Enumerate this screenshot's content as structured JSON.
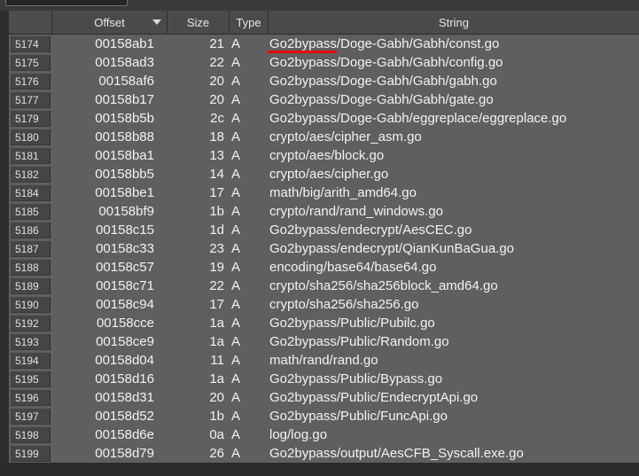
{
  "table": {
    "columns": {
      "offset": "Offset",
      "size": "Size",
      "type": "Type",
      "string": "String"
    },
    "sorted_column": "Offset",
    "rows": [
      {
        "num": "5174",
        "offset": "00158ab1",
        "size": "21",
        "type": "A",
        "string": "Go2bypass/Doge-Gabh/Gabh/const.go"
      },
      {
        "num": "5175",
        "offset": "00158ad3",
        "size": "22",
        "type": "A",
        "string": "Go2bypass/Doge-Gabh/Gabh/config.go"
      },
      {
        "num": "5176",
        "offset": "00158af6",
        "size": "20",
        "type": "A",
        "string": "Go2bypass/Doge-Gabh/Gabh/gabh.go"
      },
      {
        "num": "5177",
        "offset": "00158b17",
        "size": "20",
        "type": "A",
        "string": "Go2bypass/Doge-Gabh/Gabh/gate.go"
      },
      {
        "num": "5179",
        "offset": "00158b5b",
        "size": "2c",
        "type": "A",
        "string": "Go2bypass/Doge-Gabh/eggreplace/eggreplace.go"
      },
      {
        "num": "5180",
        "offset": "00158b88",
        "size": "18",
        "type": "A",
        "string": "crypto/aes/cipher_asm.go"
      },
      {
        "num": "5181",
        "offset": "00158ba1",
        "size": "13",
        "type": "A",
        "string": "crypto/aes/block.go"
      },
      {
        "num": "5182",
        "offset": "00158bb5",
        "size": "14",
        "type": "A",
        "string": "crypto/aes/cipher.go"
      },
      {
        "num": "5184",
        "offset": "00158be1",
        "size": "17",
        "type": "A",
        "string": "math/big/arith_amd64.go"
      },
      {
        "num": "5185",
        "offset": "00158bf9",
        "size": "1b",
        "type": "A",
        "string": "crypto/rand/rand_windows.go"
      },
      {
        "num": "5186",
        "offset": "00158c15",
        "size": "1d",
        "type": "A",
        "string": "Go2bypass/endecrypt/AesCEC.go"
      },
      {
        "num": "5187",
        "offset": "00158c33",
        "size": "23",
        "type": "A",
        "string": "Go2bypass/endecrypt/QianKunBaGua.go"
      },
      {
        "num": "5188",
        "offset": "00158c57",
        "size": "19",
        "type": "A",
        "string": "encoding/base64/base64.go"
      },
      {
        "num": "5189",
        "offset": "00158c71",
        "size": "22",
        "type": "A",
        "string": "crypto/sha256/sha256block_amd64.go"
      },
      {
        "num": "5190",
        "offset": "00158c94",
        "size": "17",
        "type": "A",
        "string": "crypto/sha256/sha256.go"
      },
      {
        "num": "5192",
        "offset": "00158cce",
        "size": "1a",
        "type": "A",
        "string": "Go2bypass/Public/Pubilc.go"
      },
      {
        "num": "5193",
        "offset": "00158ce9",
        "size": "1a",
        "type": "A",
        "string": "Go2bypass/Public/Random.go"
      },
      {
        "num": "5194",
        "offset": "00158d04",
        "size": "11",
        "type": "A",
        "string": "math/rand/rand.go"
      },
      {
        "num": "5195",
        "offset": "00158d16",
        "size": "1a",
        "type": "A",
        "string": "Go2bypass/Public/Bypass.go"
      },
      {
        "num": "5196",
        "offset": "00158d31",
        "size": "20",
        "type": "A",
        "string": "Go2bypass/Public/EndecryptApi.go"
      },
      {
        "num": "5197",
        "offset": "00158d52",
        "size": "1b",
        "type": "A",
        "string": "Go2bypass/Public/FuncApi.go"
      },
      {
        "num": "5198",
        "offset": "00158d6e",
        "size": "0a",
        "type": "A",
        "string": "log/log.go"
      },
      {
        "num": "5199",
        "offset": "00158d79",
        "size": "26",
        "type": "A",
        "string": "Go2bypass/output/AesCFB_Syscall.exe.go"
      }
    ]
  },
  "annotation": {
    "color": "#e60000"
  }
}
